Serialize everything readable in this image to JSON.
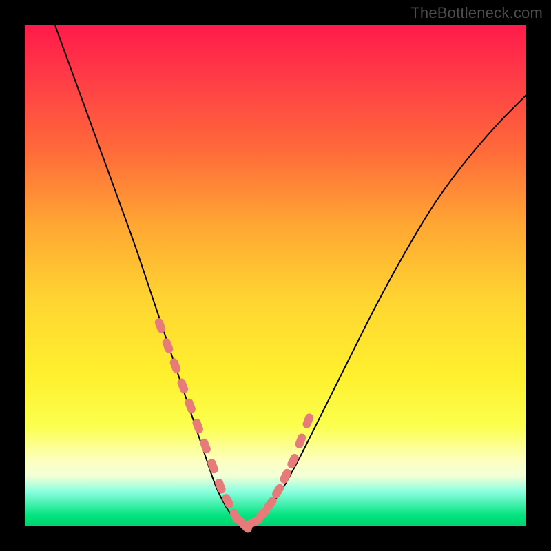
{
  "watermark": "TheBottleneck.com",
  "colors": {
    "background": "#000000",
    "curve": "#000000",
    "marker": "#e77b7a"
  },
  "chart_data": {
    "type": "line",
    "title": "",
    "xlabel": "",
    "ylabel": "",
    "xlim": [
      0,
      100
    ],
    "ylim": [
      0,
      100
    ],
    "grid": false,
    "legend": false,
    "background_gradient": [
      {
        "pos": 0,
        "color": "#ff1a4a"
      },
      {
        "pos": 55,
        "color": "#ffd531"
      },
      {
        "pos": 85,
        "color": "#fbff4d"
      },
      {
        "pos": 100,
        "color": "#00d46e"
      }
    ],
    "series": [
      {
        "name": "bottleneck-curve",
        "x": [
          6,
          10,
          14,
          18,
          22,
          24,
          26,
          28,
          30,
          32,
          34,
          36,
          38,
          40,
          42,
          44,
          46,
          50,
          54,
          58,
          62,
          66,
          70,
          76,
          82,
          88,
          94,
          100
        ],
        "values": [
          100,
          89,
          78,
          67,
          56,
          50,
          44,
          38,
          32,
          26,
          20,
          14,
          8,
          4,
          1,
          0,
          1,
          5,
          12,
          20,
          28,
          36,
          44,
          55,
          65,
          73,
          80,
          86
        ]
      }
    ],
    "markers": {
      "name": "highlighted-segment",
      "color": "#e77b7a",
      "x": [
        27,
        28.5,
        30,
        31.5,
        33,
        34.5,
        36,
        37.5,
        39,
        40.5,
        42,
        43,
        44,
        45,
        46,
        47.5,
        49,
        50.5,
        52,
        53.5,
        55,
        56.5
      ],
      "values": [
        40,
        36,
        32,
        28,
        24,
        20,
        16,
        12,
        8,
        5,
        2,
        1,
        0,
        0.5,
        1,
        2.5,
        4.5,
        7,
        10,
        13,
        17,
        21
      ]
    }
  }
}
